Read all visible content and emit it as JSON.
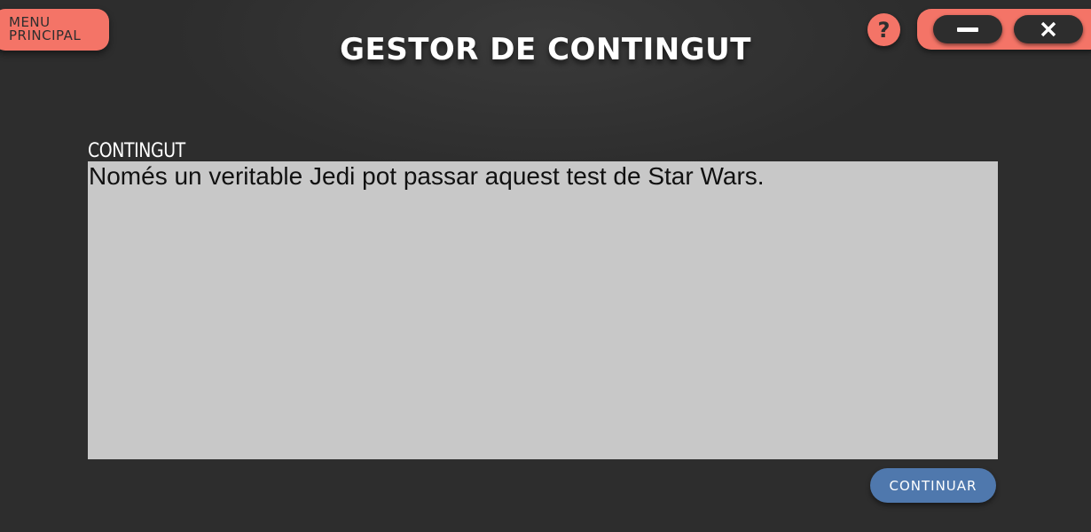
{
  "header": {
    "menu_button": {
      "line1": "MENU",
      "line2": "PRINCIPAL"
    },
    "title": "GESTOR DE CONTINGUT",
    "help_glyph": "?",
    "help_icon": "question-icon",
    "minimize_icon": "minimize-icon",
    "close_icon": "close-icon"
  },
  "form": {
    "content_label": "CONTINGUT",
    "content_value": "Només un veritable Jedi pot passar aquest test de Star Wars."
  },
  "footer": {
    "continue_label": "CONTINUAR"
  },
  "colors": {
    "background": "#2d2d2d",
    "accent": "#f47467",
    "primary_button": "#4f78ad",
    "textarea_bg": "#c8c8c8"
  }
}
